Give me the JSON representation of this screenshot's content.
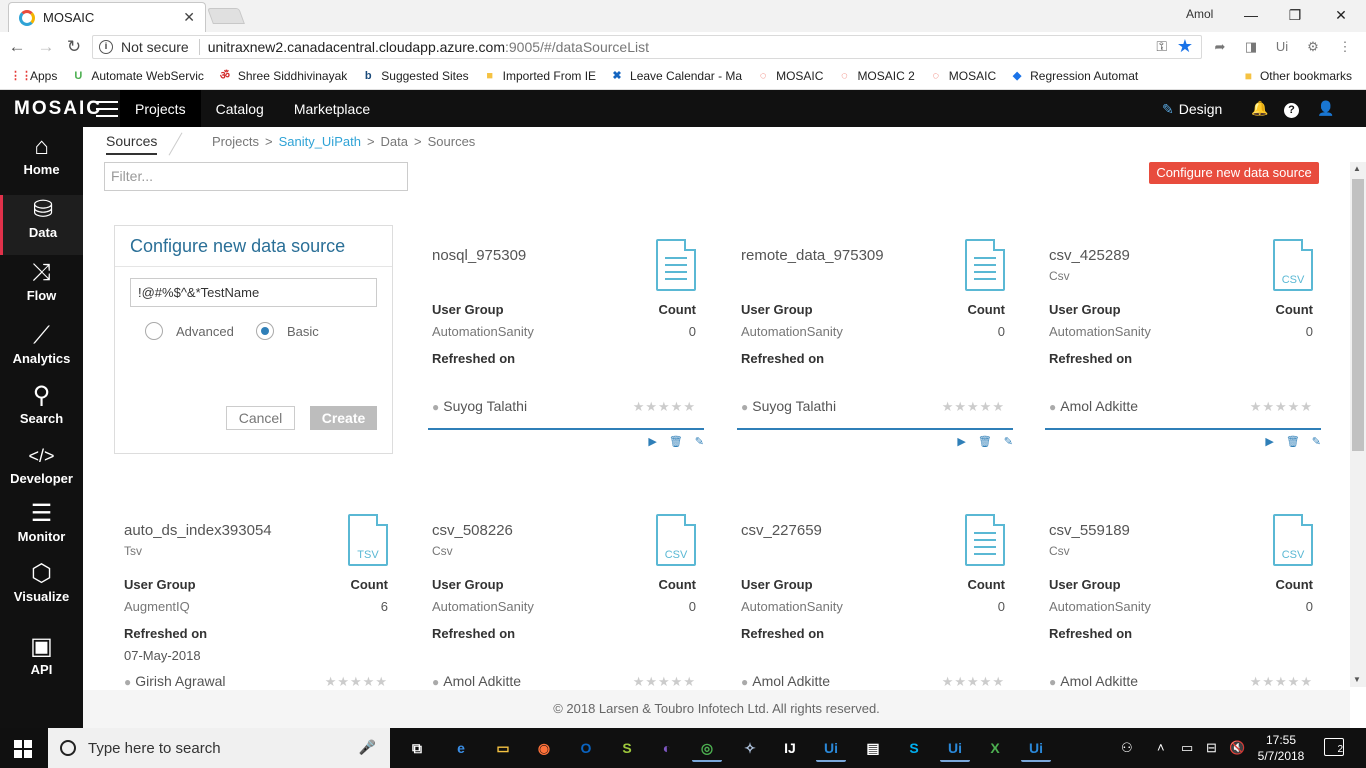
{
  "browser": {
    "tab_title": "MOSAIC",
    "tab_close": "✕",
    "window_user": "Amol",
    "minimize": "—",
    "restore": "❐",
    "close": "✕",
    "back": "←",
    "forward": "→",
    "reload": "↻",
    "info_glyph": "i",
    "not_secure": "Not secure",
    "url_host": "unitraxnew2.canadacentral.cloudapp.azure.com",
    "url_path": ":9005/#/dataSourceList",
    "key_glyph": "⚿",
    "star_glyph": "★",
    "ext_icons": [
      "➦",
      "◨",
      "Ui",
      "⚙",
      "⋮"
    ],
    "bookmarks": [
      {
        "label": "Apps",
        "icon": "apps-icon",
        "glyph": "⋮⋮",
        "color": "#e53935"
      },
      {
        "label": "Automate WebServic",
        "icon": "uipath-u-icon",
        "glyph": "U",
        "color": "#4caf50"
      },
      {
        "label": "Shree Siddhivinayak",
        "icon": "om-icon",
        "glyph": "ॐ",
        "color": "#d32f2f"
      },
      {
        "label": "Suggested Sites",
        "icon": "bing-icon",
        "glyph": "b",
        "color": "#1a4a7a"
      },
      {
        "label": "Imported From IE",
        "icon": "folder-icon",
        "glyph": "■",
        "color": "#f5c242"
      },
      {
        "label": "Leave Calendar - Ma",
        "icon": "x-logo-icon",
        "glyph": "✖",
        "color": "#1565c0"
      },
      {
        "label": "MOSAIC",
        "icon": "mosaic-icon",
        "glyph": "◌",
        "color": "#e84b3c"
      },
      {
        "label": "MOSAIC 2",
        "icon": "mosaic-icon",
        "glyph": "◌",
        "color": "#e84b3c"
      },
      {
        "label": "MOSAIC",
        "icon": "mosaic-icon",
        "glyph": "◌",
        "color": "#e84b3c"
      },
      {
        "label": "Regression Automat",
        "icon": "diamond-icon",
        "glyph": "◆",
        "color": "#1a73e8"
      }
    ],
    "other_bookmarks": "Other bookmarks"
  },
  "app": {
    "logo": "MOSAIC",
    "nav": [
      "Projects",
      "Catalog",
      "Marketplace"
    ],
    "design": "Design",
    "design_glyph": "✎",
    "bell_glyph": "🔔",
    "help_glyph": "?",
    "user_glyph": "👤"
  },
  "sidebar": [
    {
      "label": "Home",
      "icon": "home-icon",
      "glyph": "⌂"
    },
    {
      "label": "Data",
      "icon": "database-icon",
      "glyph": "⛁"
    },
    {
      "label": "Flow",
      "icon": "shuffle-icon",
      "glyph": "⤨"
    },
    {
      "label": "Analytics",
      "icon": "analytics-icon",
      "glyph": "⟋"
    },
    {
      "label": "Search",
      "icon": "search-icon",
      "glyph": "⚲"
    },
    {
      "label": "Developer",
      "icon": "code-icon",
      "glyph": "</>"
    },
    {
      "label": "Monitor",
      "icon": "monitor-icon",
      "glyph": "☰"
    },
    {
      "label": "Visualize",
      "icon": "cube-icon",
      "glyph": "⬡"
    },
    {
      "label": "API",
      "icon": "api-icon",
      "glyph": "▣"
    }
  ],
  "breadcrumb": {
    "tab": "Sources",
    "items": [
      "Projects",
      "Sanity_UiPath",
      "Data",
      "Sources"
    ],
    "sep": ">"
  },
  "filter_placeholder": "Filter...",
  "configure_button": "Configure new data source",
  "form": {
    "title": "Configure new data source",
    "name_value": "!@#%$^&*TestName",
    "advanced": "Advanced",
    "basic": "Basic",
    "cancel": "Cancel",
    "create": "Create"
  },
  "labels": {
    "user_group": "User Group",
    "count": "Count",
    "refreshed_on": "Refreshed on",
    "stars": "★★★★★"
  },
  "cards": [
    {
      "name": "nosql_975309",
      "type": "",
      "file": "doc",
      "ext": "",
      "user_group": "AutomationSanity",
      "count": "0",
      "refreshed": "",
      "owner": "Suyog Talathi"
    },
    {
      "name": "remote_data_975309",
      "type": "",
      "file": "doc",
      "ext": "",
      "user_group": "AutomationSanity",
      "count": "0",
      "refreshed": "",
      "owner": "Suyog Talathi"
    },
    {
      "name": "csv_425289",
      "type": "Csv",
      "file": "ext",
      "ext": "CSV",
      "user_group": "AutomationSanity",
      "count": "0",
      "refreshed": "",
      "owner": "Amol Adkitte"
    },
    {
      "name": "auto_ds_index393054",
      "type": "Tsv",
      "file": "ext",
      "ext": "TSV",
      "user_group": "AugmentIQ",
      "count": "6",
      "refreshed": "07-May-2018",
      "owner": "Girish Agrawal"
    },
    {
      "name": "csv_508226",
      "type": "Csv",
      "file": "ext",
      "ext": "CSV",
      "user_group": "AutomationSanity",
      "count": "0",
      "refreshed": "",
      "owner": "Amol Adkitte"
    },
    {
      "name": "csv_227659",
      "type": "",
      "file": "doc",
      "ext": "",
      "user_group": "AutomationSanity",
      "count": "0",
      "refreshed": "",
      "owner": "Amol Adkitte"
    },
    {
      "name": "csv_559189",
      "type": "Csv",
      "file": "ext",
      "ext": "CSV",
      "user_group": "AutomationSanity",
      "count": "0",
      "refreshed": "",
      "owner": "Amol Adkitte"
    }
  ],
  "card_actions": {
    "play": "▶",
    "delete": "🗑",
    "edit": "✎"
  },
  "footer": "© 2018 Larsen & Toubro Infotech Ltd. All rights reserved.",
  "taskbar": {
    "search_placeholder": "Type here to search",
    "mic_glyph": "🎤",
    "apps": [
      {
        "name": "task-view-icon",
        "glyph": "⧉",
        "color": "#fff"
      },
      {
        "name": "edge-icon",
        "glyph": "e",
        "color": "#3a8ee6"
      },
      {
        "name": "file-explorer-icon",
        "glyph": "▭",
        "color": "#f5c242"
      },
      {
        "name": "firefox-icon",
        "glyph": "◉",
        "color": "#ff7139"
      },
      {
        "name": "outlook-icon",
        "glyph": "O",
        "color": "#0a64c2"
      },
      {
        "name": "sharepoint-icon",
        "glyph": "S",
        "color": "#9ec83c"
      },
      {
        "name": "eclipse-icon",
        "glyph": "◐",
        "color": "#7e57c2"
      },
      {
        "name": "chrome-icon",
        "glyph": "◎",
        "color": "#4caf50"
      },
      {
        "name": "paint-icon",
        "glyph": "✧",
        "color": "#b0c4de"
      },
      {
        "name": "intellij-icon",
        "glyph": "IJ",
        "color": "#fff"
      },
      {
        "name": "uipath-icon",
        "glyph": "Ui",
        "color": "#2a88d8"
      },
      {
        "name": "notepad-icon",
        "glyph": "▤",
        "color": "#fff"
      },
      {
        "name": "skype-icon",
        "glyph": "S",
        "color": "#00aff0"
      },
      {
        "name": "uipath-studio-icon",
        "glyph": "Ui",
        "color": "#2a88d8"
      },
      {
        "name": "excel-icon",
        "glyph": "X",
        "color": "#4caf50"
      },
      {
        "name": "uipath-robot-icon",
        "glyph": "Ui",
        "color": "#2a88d8"
      }
    ],
    "tray": [
      "⚇",
      "˄",
      "▭",
      "⊟",
      "🔇"
    ],
    "time": "17:55",
    "date": "5/7/2018",
    "notifications": "2"
  }
}
